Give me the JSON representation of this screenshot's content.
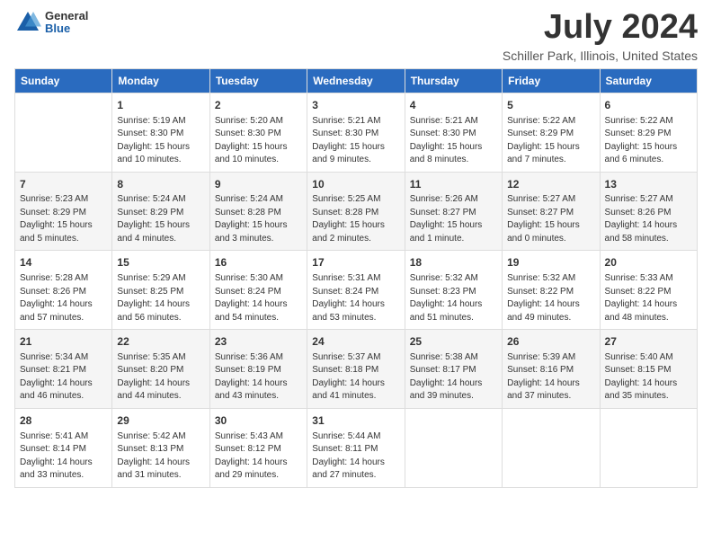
{
  "header": {
    "logo_general": "General",
    "logo_blue": "Blue",
    "title": "July 2024",
    "subtitle": "Schiller Park, Illinois, United States"
  },
  "calendar": {
    "days_of_week": [
      "Sunday",
      "Monday",
      "Tuesday",
      "Wednesday",
      "Thursday",
      "Friday",
      "Saturday"
    ],
    "weeks": [
      [
        {
          "day": "",
          "text": ""
        },
        {
          "day": "1",
          "text": "Sunrise: 5:19 AM\nSunset: 8:30 PM\nDaylight: 15 hours\nand 10 minutes."
        },
        {
          "day": "2",
          "text": "Sunrise: 5:20 AM\nSunset: 8:30 PM\nDaylight: 15 hours\nand 10 minutes."
        },
        {
          "day": "3",
          "text": "Sunrise: 5:21 AM\nSunset: 8:30 PM\nDaylight: 15 hours\nand 9 minutes."
        },
        {
          "day": "4",
          "text": "Sunrise: 5:21 AM\nSunset: 8:30 PM\nDaylight: 15 hours\nand 8 minutes."
        },
        {
          "day": "5",
          "text": "Sunrise: 5:22 AM\nSunset: 8:29 PM\nDaylight: 15 hours\nand 7 minutes."
        },
        {
          "day": "6",
          "text": "Sunrise: 5:22 AM\nSunset: 8:29 PM\nDaylight: 15 hours\nand 6 minutes."
        }
      ],
      [
        {
          "day": "7",
          "text": "Sunrise: 5:23 AM\nSunset: 8:29 PM\nDaylight: 15 hours\nand 5 minutes."
        },
        {
          "day": "8",
          "text": "Sunrise: 5:24 AM\nSunset: 8:29 PM\nDaylight: 15 hours\nand 4 minutes."
        },
        {
          "day": "9",
          "text": "Sunrise: 5:24 AM\nSunset: 8:28 PM\nDaylight: 15 hours\nand 3 minutes."
        },
        {
          "day": "10",
          "text": "Sunrise: 5:25 AM\nSunset: 8:28 PM\nDaylight: 15 hours\nand 2 minutes."
        },
        {
          "day": "11",
          "text": "Sunrise: 5:26 AM\nSunset: 8:27 PM\nDaylight: 15 hours\nand 1 minute."
        },
        {
          "day": "12",
          "text": "Sunrise: 5:27 AM\nSunset: 8:27 PM\nDaylight: 15 hours\nand 0 minutes."
        },
        {
          "day": "13",
          "text": "Sunrise: 5:27 AM\nSunset: 8:26 PM\nDaylight: 14 hours\nand 58 minutes."
        }
      ],
      [
        {
          "day": "14",
          "text": "Sunrise: 5:28 AM\nSunset: 8:26 PM\nDaylight: 14 hours\nand 57 minutes."
        },
        {
          "day": "15",
          "text": "Sunrise: 5:29 AM\nSunset: 8:25 PM\nDaylight: 14 hours\nand 56 minutes."
        },
        {
          "day": "16",
          "text": "Sunrise: 5:30 AM\nSunset: 8:24 PM\nDaylight: 14 hours\nand 54 minutes."
        },
        {
          "day": "17",
          "text": "Sunrise: 5:31 AM\nSunset: 8:24 PM\nDaylight: 14 hours\nand 53 minutes."
        },
        {
          "day": "18",
          "text": "Sunrise: 5:32 AM\nSunset: 8:23 PM\nDaylight: 14 hours\nand 51 minutes."
        },
        {
          "day": "19",
          "text": "Sunrise: 5:32 AM\nSunset: 8:22 PM\nDaylight: 14 hours\nand 49 minutes."
        },
        {
          "day": "20",
          "text": "Sunrise: 5:33 AM\nSunset: 8:22 PM\nDaylight: 14 hours\nand 48 minutes."
        }
      ],
      [
        {
          "day": "21",
          "text": "Sunrise: 5:34 AM\nSunset: 8:21 PM\nDaylight: 14 hours\nand 46 minutes."
        },
        {
          "day": "22",
          "text": "Sunrise: 5:35 AM\nSunset: 8:20 PM\nDaylight: 14 hours\nand 44 minutes."
        },
        {
          "day": "23",
          "text": "Sunrise: 5:36 AM\nSunset: 8:19 PM\nDaylight: 14 hours\nand 43 minutes."
        },
        {
          "day": "24",
          "text": "Sunrise: 5:37 AM\nSunset: 8:18 PM\nDaylight: 14 hours\nand 41 minutes."
        },
        {
          "day": "25",
          "text": "Sunrise: 5:38 AM\nSunset: 8:17 PM\nDaylight: 14 hours\nand 39 minutes."
        },
        {
          "day": "26",
          "text": "Sunrise: 5:39 AM\nSunset: 8:16 PM\nDaylight: 14 hours\nand 37 minutes."
        },
        {
          "day": "27",
          "text": "Sunrise: 5:40 AM\nSunset: 8:15 PM\nDaylight: 14 hours\nand 35 minutes."
        }
      ],
      [
        {
          "day": "28",
          "text": "Sunrise: 5:41 AM\nSunset: 8:14 PM\nDaylight: 14 hours\nand 33 minutes."
        },
        {
          "day": "29",
          "text": "Sunrise: 5:42 AM\nSunset: 8:13 PM\nDaylight: 14 hours\nand 31 minutes."
        },
        {
          "day": "30",
          "text": "Sunrise: 5:43 AM\nSunset: 8:12 PM\nDaylight: 14 hours\nand 29 minutes."
        },
        {
          "day": "31",
          "text": "Sunrise: 5:44 AM\nSunset: 8:11 PM\nDaylight: 14 hours\nand 27 minutes."
        },
        {
          "day": "",
          "text": ""
        },
        {
          "day": "",
          "text": ""
        },
        {
          "day": "",
          "text": ""
        }
      ]
    ]
  }
}
